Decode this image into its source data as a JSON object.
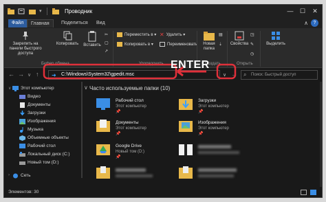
{
  "window": {
    "title": "Проводник",
    "controls": {
      "minimize": "—",
      "maximize": "☐",
      "close": "✕"
    }
  },
  "ribbon_tabs": [
    {
      "label": "Файл"
    },
    {
      "label": "Главная"
    },
    {
      "label": "Поделиться"
    },
    {
      "label": "Вид"
    }
  ],
  "ribbon": {
    "pin_quick_access": "Закрепить на панели быстрого доступа",
    "copy": "Копировать",
    "paste": "Вставить",
    "move_to": "Переместить в ▾",
    "copy_to": "Копировать в ▾",
    "delete": "Удалить ▾",
    "rename": "Переименовать",
    "new_folder": "Новая папка",
    "properties": "Свойства",
    "select": "Выделить",
    "groups": {
      "clipboard": "Буфер обмена",
      "organize": "Упорядочить",
      "create": "Создать",
      "open": "Открыть"
    }
  },
  "address_bar": {
    "path": "C:\\Windows\\System32\\gpedit.msc",
    "search_placeholder": "Поиск: Быстрый доступ",
    "annotation": "ENTER"
  },
  "nav_pane": {
    "items": [
      {
        "label": "Этот компьютер"
      },
      {
        "label": "Видео"
      },
      {
        "label": "Документы"
      },
      {
        "label": "Загрузки"
      },
      {
        "label": "Изображения"
      },
      {
        "label": "Музыка"
      },
      {
        "label": "Объемные объекты"
      },
      {
        "label": "Рабочий стол"
      },
      {
        "label": "Локальный диск (C:)"
      },
      {
        "label": "Новый том (D:)"
      },
      {
        "label": "Сеть"
      }
    ]
  },
  "content": {
    "section_title": "Часто используемые папки (10)",
    "tiles": [
      {
        "name": "Рабочий стол",
        "sub": "Этот компьютер"
      },
      {
        "name": "Загрузки",
        "sub": "Этот компьютер"
      },
      {
        "name": "Документы",
        "sub": "Этот компьютер"
      },
      {
        "name": "Изображения",
        "sub": "Этот компьютер"
      },
      {
        "name": "Google Drive",
        "sub": "Новый том (D:)"
      }
    ]
  },
  "status_bar": {
    "elements_count": "Элементов: 30"
  },
  "colors": {
    "background": "#191919",
    "ribbon": "#2b2b2b",
    "file_tab": "#2d5c9e",
    "annotation_red": "#e0303a",
    "folder_yellow": "#e8b84a"
  }
}
